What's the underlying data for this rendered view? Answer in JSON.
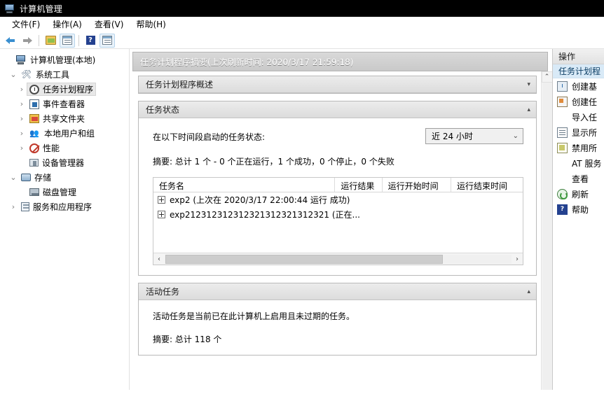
{
  "window": {
    "title": "计算机管理",
    "icon": "computer-management-icon"
  },
  "menu": {
    "items": [
      {
        "label": "文件(F)"
      },
      {
        "label": "操作(A)"
      },
      {
        "label": "查看(V)"
      },
      {
        "label": "帮助(H)"
      }
    ]
  },
  "toolbar": {
    "buttons": [
      {
        "name": "back-icon",
        "label": ""
      },
      {
        "name": "forward-icon",
        "label": ""
      },
      {
        "name": "up-folder-icon",
        "label": ""
      },
      {
        "name": "show-list-icon",
        "label": ""
      },
      {
        "name": "help-icon",
        "label": ""
      },
      {
        "name": "show-pane-icon",
        "label": ""
      }
    ]
  },
  "tree": {
    "root": {
      "label": "计算机管理(本地)",
      "icon": "computer-icon",
      "expander": ""
    },
    "items": [
      {
        "label": "系统工具",
        "icon": "tools-icon",
        "expander": "⌄",
        "indent": 1,
        "selected": false
      },
      {
        "label": "任务计划程序",
        "icon": "clock-icon",
        "expander": "›",
        "indent": 2,
        "selected": true
      },
      {
        "label": "事件查看器",
        "icon": "event-viewer-icon",
        "expander": "›",
        "indent": 2,
        "selected": false
      },
      {
        "label": "共享文件夹",
        "icon": "shared-folder-icon",
        "expander": "›",
        "indent": 2,
        "selected": false
      },
      {
        "label": "本地用户和组",
        "icon": "users-groups-icon",
        "expander": "›",
        "indent": 2,
        "selected": false
      },
      {
        "label": "性能",
        "icon": "performance-icon",
        "expander": "›",
        "indent": 2,
        "selected": false
      },
      {
        "label": "设备管理器",
        "icon": "device-manager-icon",
        "expander": "",
        "indent": 2,
        "selected": false
      },
      {
        "label": "存储",
        "icon": "storage-icon",
        "expander": "⌄",
        "indent": 1,
        "selected": false
      },
      {
        "label": "磁盘管理",
        "icon": "disk-management-icon",
        "expander": "",
        "indent": 2,
        "selected": false
      },
      {
        "label": "服务和应用程序",
        "icon": "services-apps-icon",
        "expander": "›",
        "indent": 1,
        "selected": false
      }
    ]
  },
  "center": {
    "header": "任务计划程序摘要(上次刷新时间: 2020/3/17 21:59:18)",
    "panels": {
      "overview": {
        "title": "任务计划程序概述",
        "chevron": "▾"
      },
      "status": {
        "title": "任务状态",
        "chevron": "▴",
        "period_label": "在以下时间段启动的任务状态:",
        "period_value": "近 24 小时",
        "period_chevron": "⌄",
        "summary": "摘要: 总计 1 个 - 0 个正在运行，1 个成功，0 个停止，0 个失败",
        "grid": {
          "columns": [
            "任务名",
            "运行结果",
            "运行开始时间",
            "运行结束时间"
          ],
          "rows": [
            {
              "name": "exp2 (上次在 2020/3/17 22:00:44 运行 成功)",
              "result": "",
              "start": "",
              "end": ""
            },
            {
              "name": "exp212312312312321312321312321 (正在...",
              "result": "",
              "start": "",
              "end": ""
            }
          ]
        },
        "hscroll": {
          "left_arrow": "‹",
          "right_arrow": "›"
        }
      },
      "active": {
        "title": "活动任务",
        "chevron": "▴",
        "description": "活动任务是当前已在此计算机上启用且未过期的任务。",
        "summary": "摘要: 总计 118 个"
      }
    },
    "vscroll": {
      "up_arrow": "⌃"
    }
  },
  "actions": {
    "title": "操作",
    "group_header": "任务计划程",
    "items": [
      {
        "label": "创建基",
        "icon": "create-basic-task-icon"
      },
      {
        "label": "创建任",
        "icon": "create-task-icon"
      },
      {
        "label": "导入任",
        "icon": ""
      },
      {
        "label": "显示所",
        "icon": "show-all-running-icon"
      },
      {
        "label": "禁用所",
        "icon": "disable-all-history-icon"
      },
      {
        "label": "AT 服务",
        "icon": ""
      },
      {
        "label": "查看",
        "icon": ""
      },
      {
        "label": "刷新",
        "icon": "refresh-icon"
      },
      {
        "label": "帮助",
        "icon": "help-icon"
      }
    ]
  }
}
